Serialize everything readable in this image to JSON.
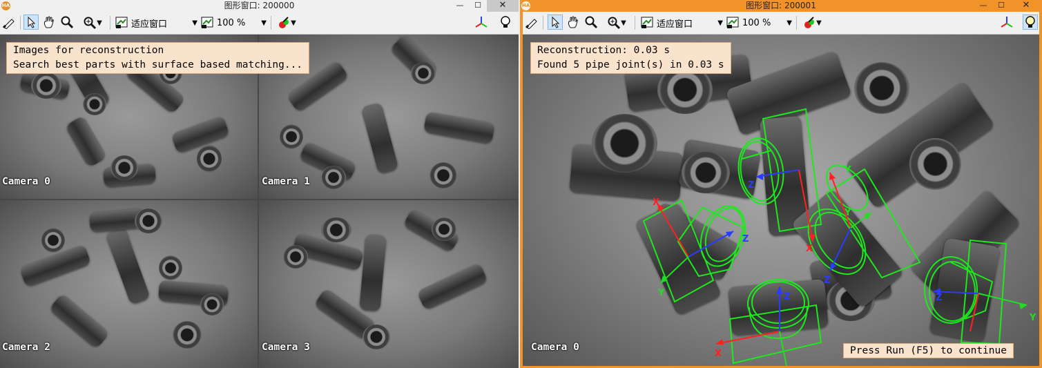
{
  "windows": [
    {
      "title": "图形窗口: 200000",
      "logo": "HA",
      "toolbar": {
        "zoom_mode": "适应窗口",
        "zoom_percent": "100 %"
      },
      "message_lines": [
        "Images for reconstruction",
        "Search best parts with surface based matching..."
      ],
      "cameras": [
        "Camera 0",
        "Camera 1",
        "Camera 2",
        "Camera 3"
      ]
    },
    {
      "title": "图形窗口: 200001",
      "logo": "HA",
      "toolbar": {
        "zoom_mode": "适应窗口",
        "zoom_percent": "100 %"
      },
      "message_lines": [
        "Reconstruction: 0.03 s",
        "Found 5 pipe joint(s) in 0.03 s"
      ],
      "camera_label": "Camera 0",
      "continue_text": "Press Run (F5) to continue",
      "axis_labels": {
        "x": "X",
        "y": "Y",
        "z": "Z"
      },
      "colors": {
        "contour": "#1ee81e",
        "x_axis": "#ff2020",
        "y_axis": "#22dd22",
        "z_axis": "#2a3cff"
      }
    }
  ],
  "window_buttons": {
    "minimize": "—",
    "maximize": "☐",
    "close": "✕"
  },
  "icons": [
    "brush-icon",
    "pointer-icon",
    "hand-icon",
    "magnifier-icon",
    "zoom-in-icon",
    "fit-window-icon",
    "zoom-percent-icon",
    "color-pick-icon",
    "3d-axes-icon",
    "lightbulb-icon"
  ]
}
